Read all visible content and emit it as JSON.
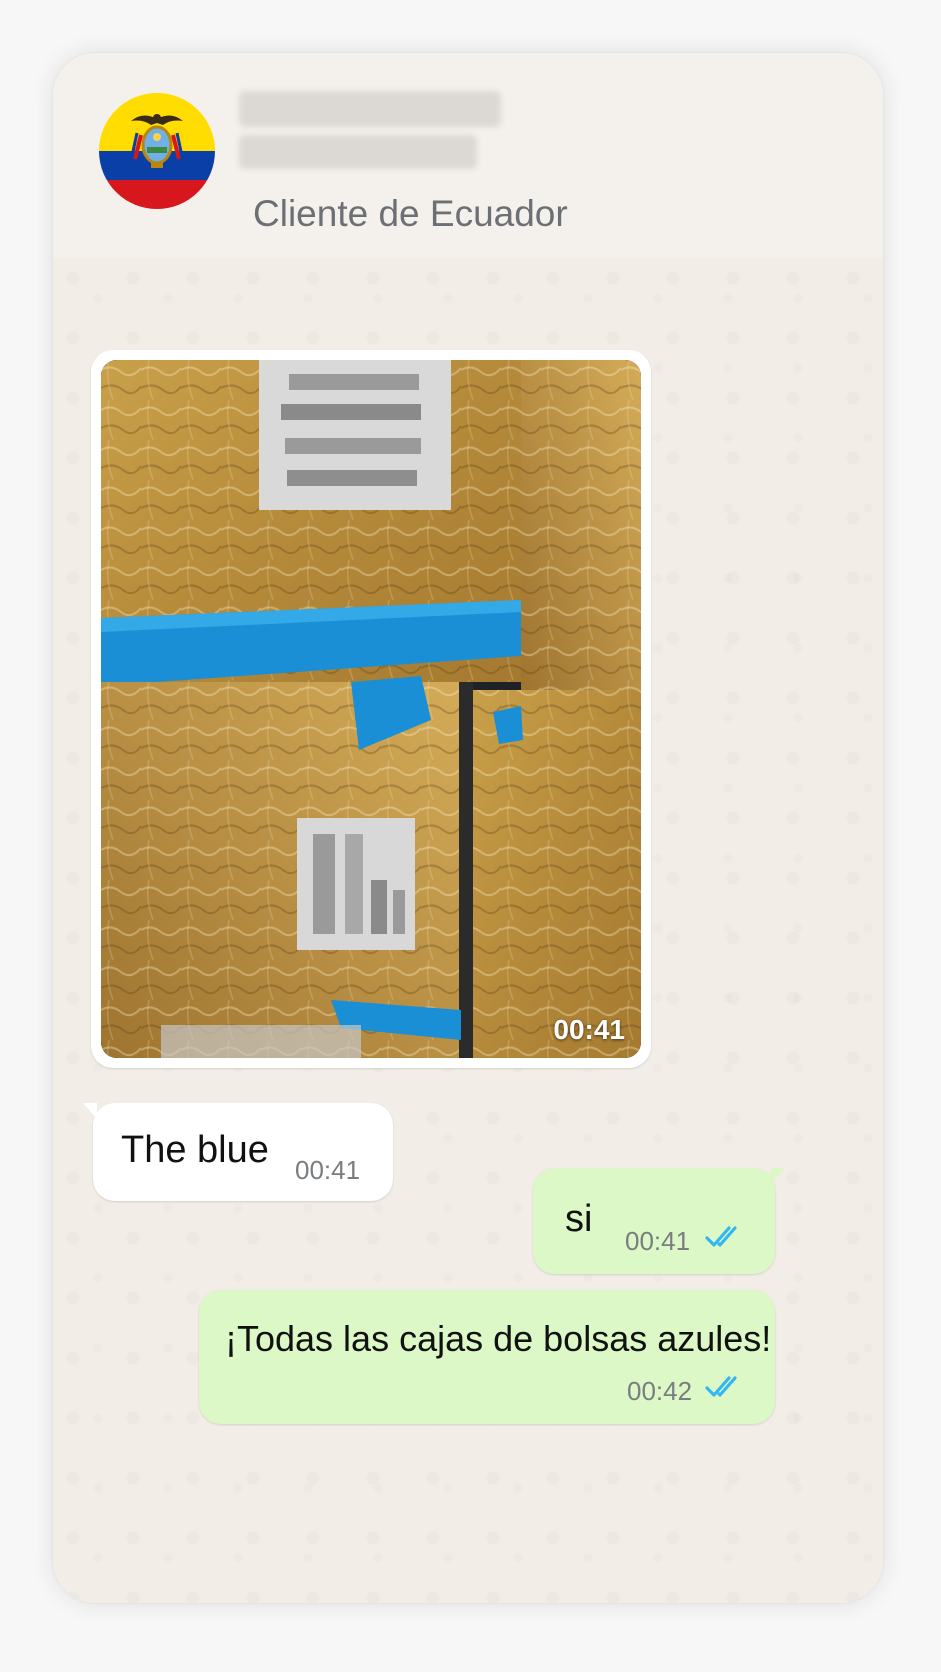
{
  "contact": {
    "subtitle": "Cliente de Ecuador",
    "avatar": "ecuador-flag"
  },
  "messages": [
    {
      "type": "video",
      "direction": "incoming",
      "time": "00:41"
    },
    {
      "type": "text",
      "direction": "incoming",
      "text": "The blue",
      "time": "00:41"
    },
    {
      "type": "text",
      "direction": "outgoing",
      "text": "si",
      "time": "00:41",
      "status": "read"
    },
    {
      "type": "text",
      "direction": "outgoing",
      "text": "¡Todas las cajas de bolsas azules!",
      "time": "00:42",
      "status": "read"
    }
  ],
  "colors": {
    "outgoing_bubble": "#dcf8c6",
    "incoming_bubble": "#ffffff",
    "read_ticks": "#34b7f1",
    "chat_background": "#f2ede6"
  }
}
